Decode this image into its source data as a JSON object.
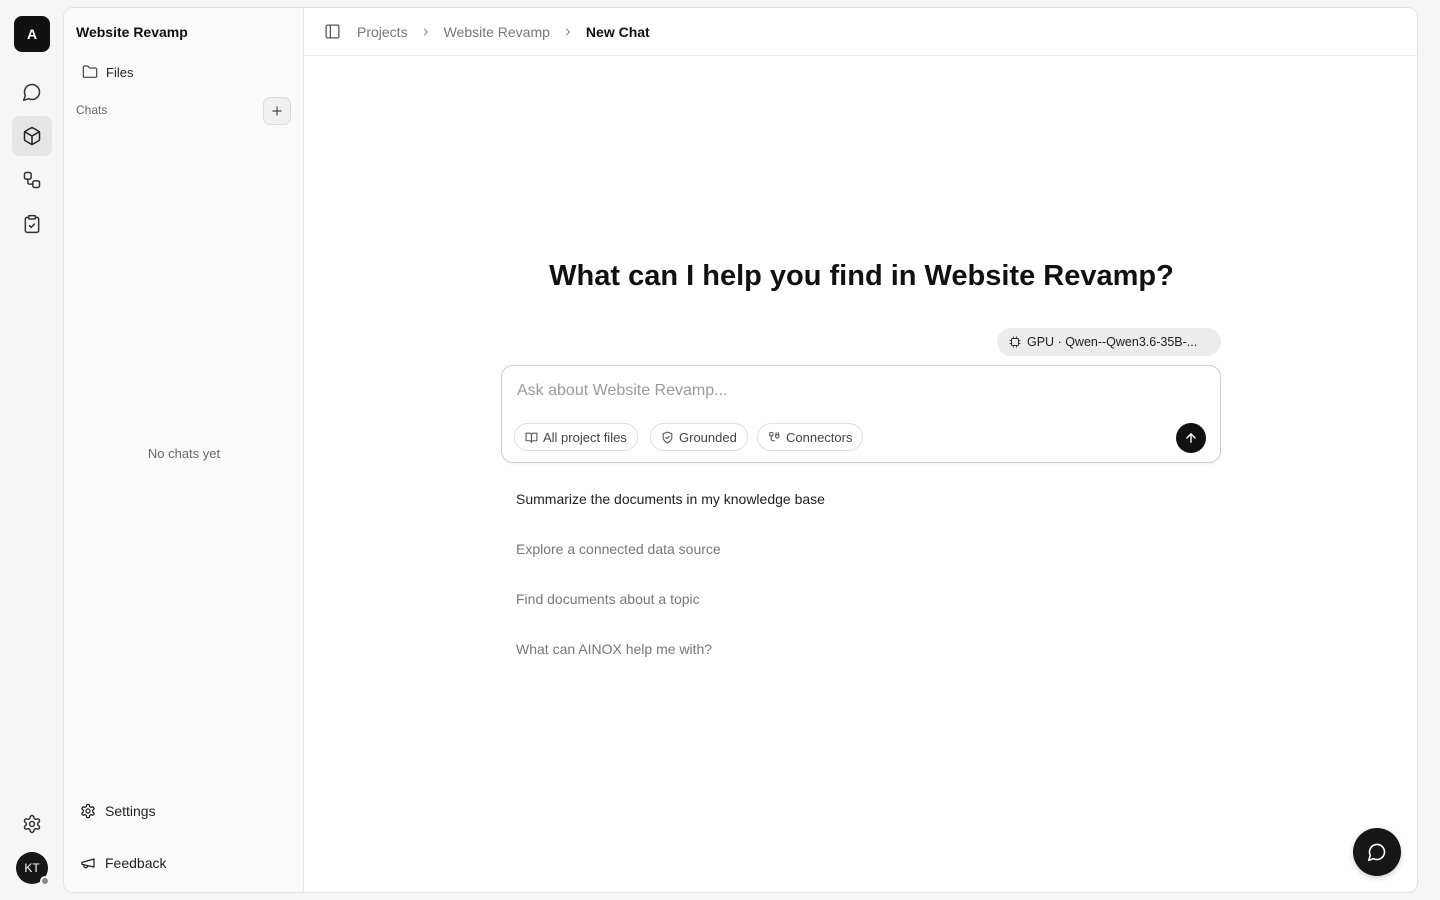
{
  "rail": {
    "logo_letter": "A",
    "items": [
      {
        "name": "chat",
        "icon": "message-circle-icon",
        "active": false
      },
      {
        "name": "projects",
        "icon": "box-icon",
        "active": true
      },
      {
        "name": "workflows",
        "icon": "workflow-icon",
        "active": false
      },
      {
        "name": "tasks",
        "icon": "clipboard-check-icon",
        "active": false
      }
    ],
    "settings_icon": "gear-icon",
    "avatar_initials": "KT"
  },
  "project_sidebar": {
    "title": "Website Revamp",
    "files_label": "Files",
    "chats_label": "Chats",
    "empty_text": "No chats yet",
    "settings_label": "Settings",
    "feedback_label": "Feedback"
  },
  "breadcrumb": {
    "items": [
      "Projects",
      "Website Revamp"
    ],
    "current": "New Chat"
  },
  "hero": {
    "title": "What can I help you find in Website Revamp?"
  },
  "model": {
    "label": "GPU · Qwen--Qwen3.6-35B-..."
  },
  "composer": {
    "placeholder": "Ask about Website Revamp...",
    "value": "",
    "chips": [
      "All project files",
      "Grounded",
      "Connectors"
    ]
  },
  "suggestions": [
    "Summarize the documents in my knowledge base",
    "Explore a connected data source",
    "Find documents about a topic",
    "What can AINOX help me with?"
  ],
  "colors": {
    "accent": "#111111",
    "background": "#f6f6f6",
    "surface": "#ffffff"
  }
}
